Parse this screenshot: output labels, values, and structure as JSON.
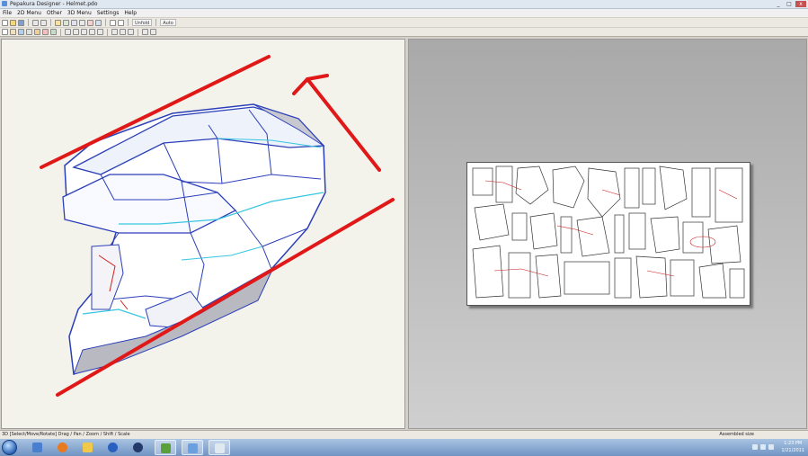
{
  "window": {
    "title": "Pepakura Designer - Helmet.pdo",
    "buttons": [
      "_",
      "□",
      "x"
    ]
  },
  "menu": [
    "File",
    "2D Menu",
    "Other",
    "3D Menu",
    "Settings",
    "Help"
  ],
  "toolbar": {
    "unfold_label": "Unfold",
    "auto_label": "Auto"
  },
  "views": {
    "left": "3D view",
    "right": "2D layout"
  },
  "status": {
    "left": "3D [Select/Move/Rotate] Drag / Pan / Zoom / Shift / Scale",
    "right": "Assembled size"
  },
  "taskbar": {
    "apps": [
      "windows-explorer",
      "firefox",
      "folder",
      "ie",
      "media-player",
      "game",
      "pepakura",
      "notepad"
    ]
  },
  "clock": {
    "time": "1:23 PM",
    "date": "1/21/2011"
  },
  "colors": {
    "accent": "#e01818",
    "mesh": "#3a4ec8",
    "edge": "#36c6e0"
  }
}
